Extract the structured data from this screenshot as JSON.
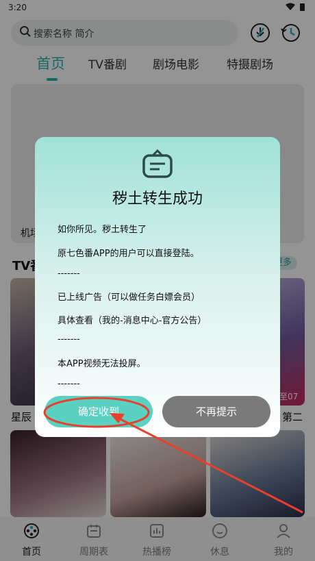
{
  "status_bar": {
    "time": "3:20"
  },
  "search": {
    "placeholder": "搜索名称 简介"
  },
  "tabs": [
    {
      "label": "首页"
    },
    {
      "label": "TV番剧"
    },
    {
      "label": "剧场电影"
    },
    {
      "label": "特摄剧场"
    }
  ],
  "banner": {
    "caption_partial": "机场"
  },
  "section": {
    "title_partial": "TV番",
    "more_partial": "更多"
  },
  "cards": [
    {
      "title_partial": "星辰"
    },
    {
      "title_partial": "第二",
      "episode_partial": "至07"
    }
  ],
  "dialog": {
    "title": "秽土转生成功",
    "lines": [
      "如你所见。秽土转生了",
      "原七色番APP的用户可以直接登陆。",
      "-------",
      "已上线广告（可以做任务白嫖会员）",
      "具体查看（我的-消息中心-官方公告）",
      "-------",
      "本APP视频无法投屏。",
      "-------"
    ],
    "confirm_label": "确定收到",
    "cancel_label": "不再提示"
  },
  "bottom_nav": [
    {
      "label": "首页",
      "icon": "home-film-icon"
    },
    {
      "label": "周期表",
      "icon": "calendar-icon"
    },
    {
      "label": "热播榜",
      "icon": "chart-icon"
    },
    {
      "label": "休息",
      "icon": "face-icon"
    },
    {
      "label": "我的",
      "icon": "person-icon"
    }
  ],
  "colors": {
    "accent": "#27b3ad",
    "annotation": "#e8402c"
  }
}
